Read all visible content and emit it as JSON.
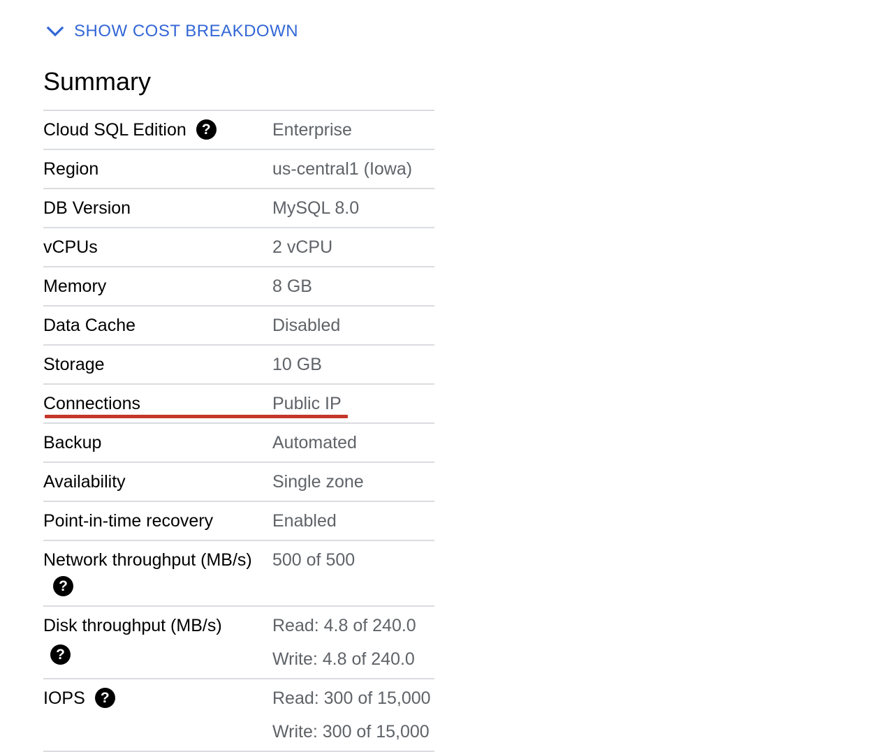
{
  "toggle": {
    "label": "SHOW COST BREAKDOWN",
    "icon": "chevron-down-icon"
  },
  "summary": {
    "title": "Summary",
    "rows": [
      {
        "key": "Cloud SQL Edition",
        "values": [
          "Enterprise"
        ],
        "help": true
      },
      {
        "key": "Region",
        "values": [
          "us-central1 (Iowa)"
        ]
      },
      {
        "key": "DB Version",
        "values": [
          "MySQL 8.0"
        ]
      },
      {
        "key": "vCPUs",
        "values": [
          "2 vCPU"
        ]
      },
      {
        "key": "Memory",
        "values": [
          "8 GB"
        ]
      },
      {
        "key": "Data Cache",
        "values": [
          "Disabled"
        ]
      },
      {
        "key": "Storage",
        "values": [
          "10 GB"
        ]
      },
      {
        "key": "Connections",
        "values": [
          "Public IP"
        ],
        "highlight": true
      },
      {
        "key": "Backup",
        "values": [
          "Automated"
        ]
      },
      {
        "key": "Availability",
        "values": [
          "Single zone"
        ]
      },
      {
        "key": "Point-in-time recovery",
        "values": [
          "Enabled"
        ]
      },
      {
        "key": "Network throughput (MB/s)",
        "values": [
          "500 of 500"
        ],
        "help": true
      },
      {
        "key": "Disk throughput (MB/s)",
        "values": [
          "Read: 4.8 of 240.0",
          "Write: 4.8 of 240.0"
        ],
        "help": true
      },
      {
        "key": "IOPS",
        "values": [
          "Read: 300 of 15,000",
          "Write: 300 of 15,000"
        ],
        "help": true
      }
    ]
  },
  "colors": {
    "accent": "#3367d6",
    "highlight": "#c5362b",
    "divider": "#dadce0"
  }
}
